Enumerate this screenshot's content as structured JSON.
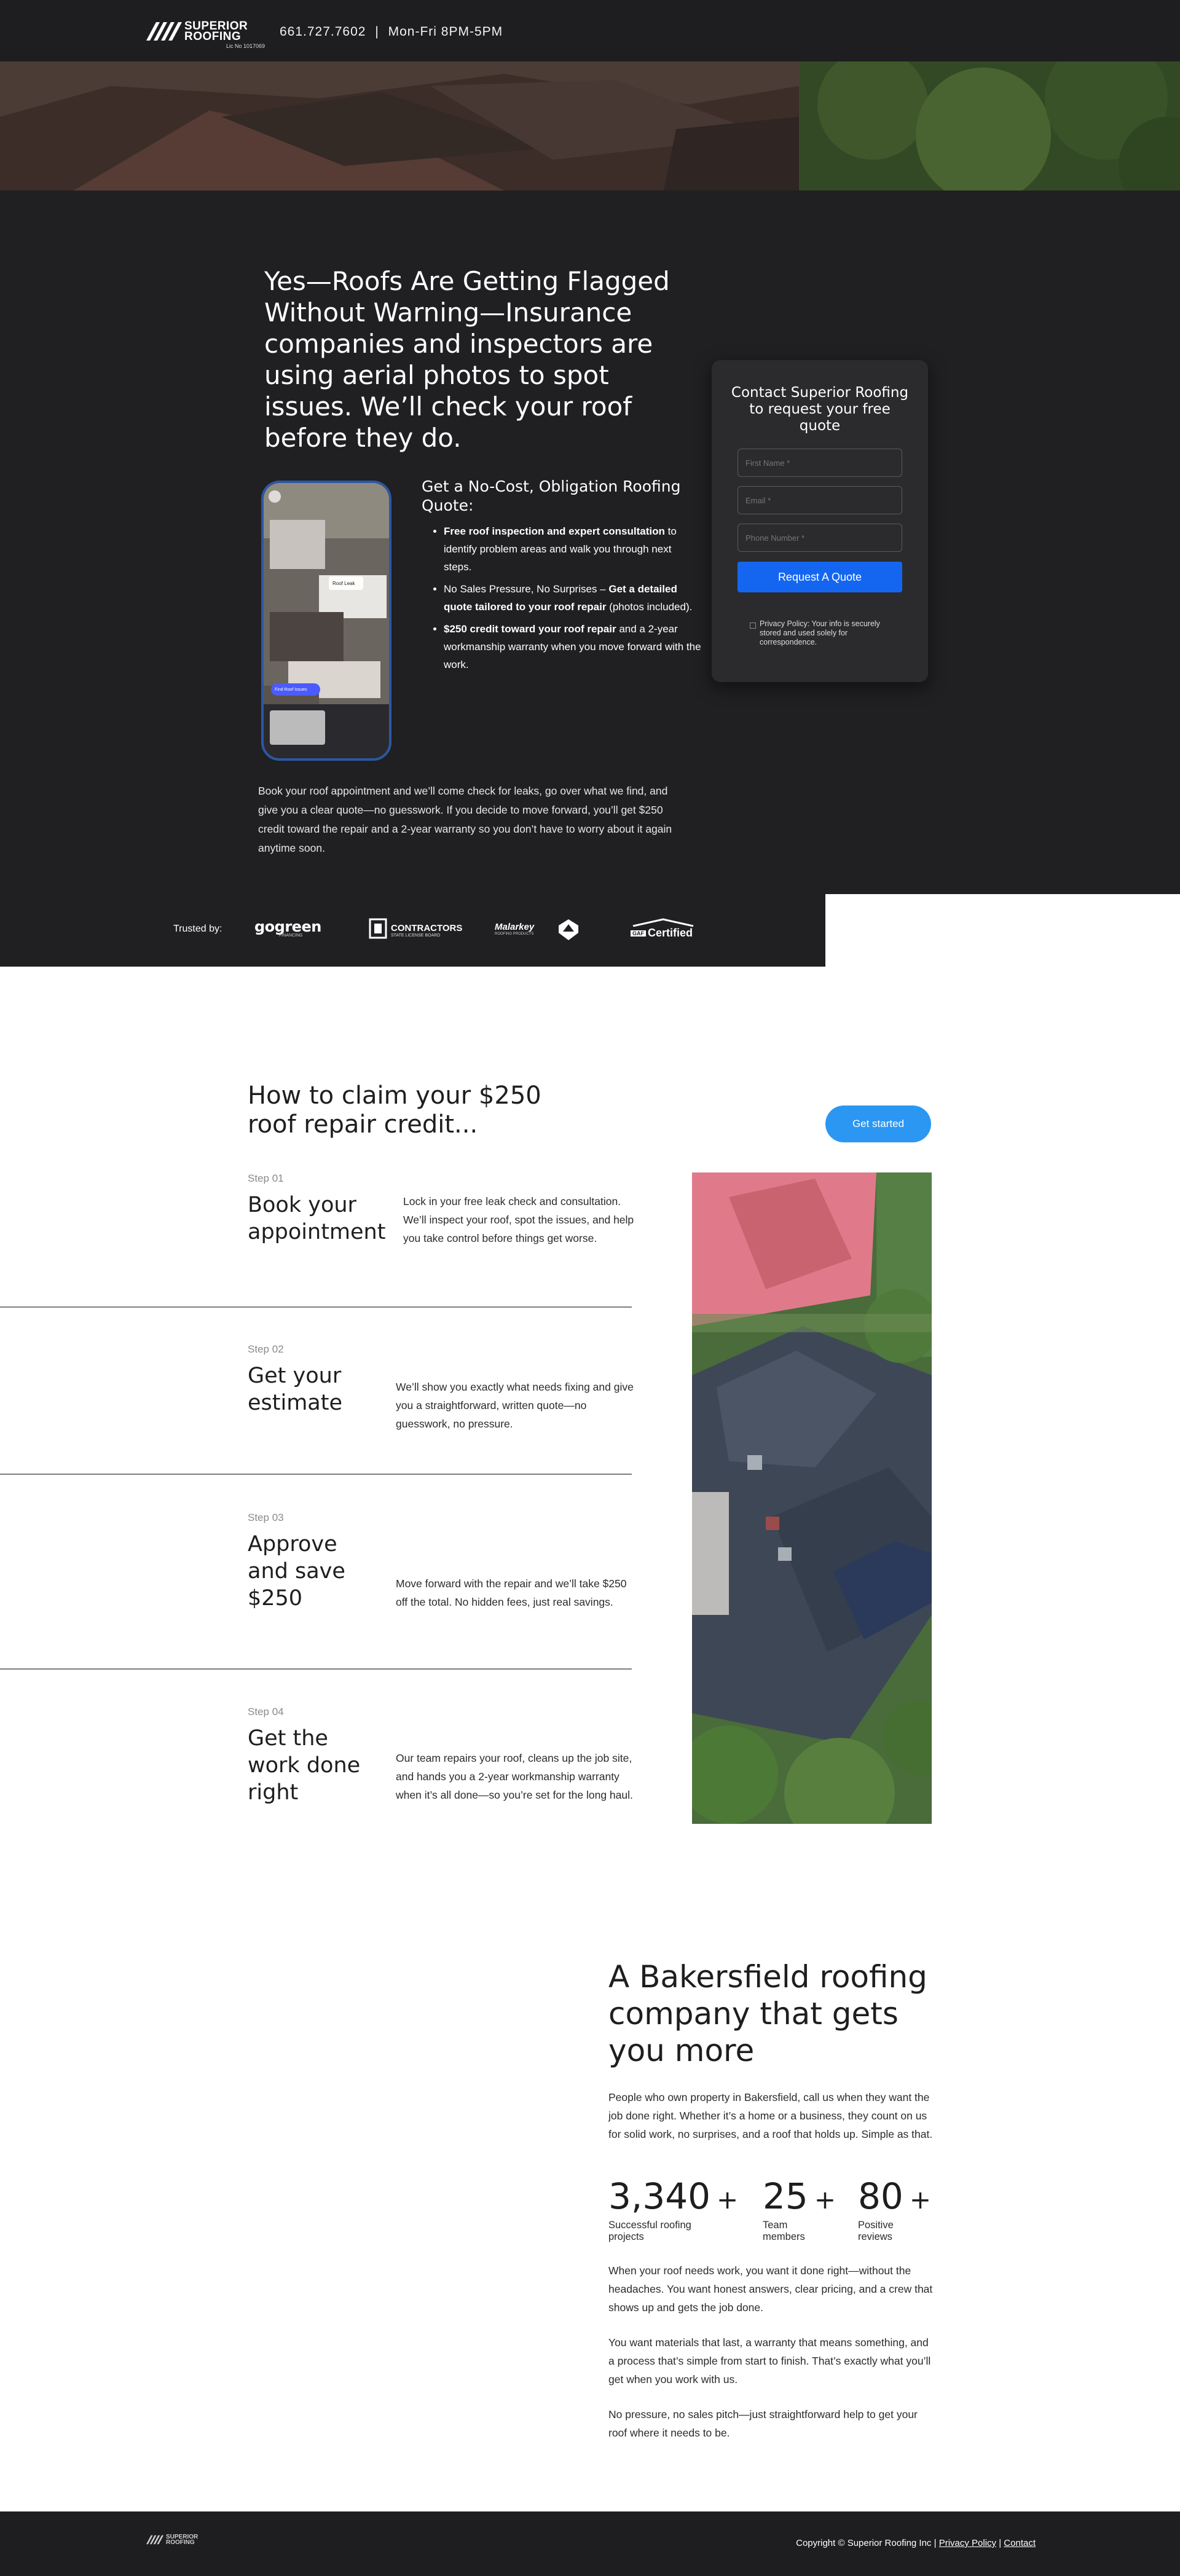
{
  "header": {
    "logo_top": "SUPERIOR",
    "logo_bottom": "ROOFING",
    "license": "Lic No 1017069",
    "phone": "661.727.7602",
    "separator": "|",
    "hours": "Mon-Fri 8PM-5PM"
  },
  "hero": {
    "headline": "Yes—Roofs Are Getting Flagged Without Warning—Insurance companies and inspectors are using aerial photos to spot issues. We’ll check your roof before they do.",
    "phone_badge": "Roof Leak",
    "phone_button": "Find Roof Issues",
    "offer_title": "Get a No-Cost, Obligation Roofing Quote:",
    "offer_items": [
      {
        "bold": "Free roof inspection and expert consultation",
        "text": " to identify problem areas and walk you through next steps."
      },
      {
        "pre": "No Sales Pressure, No Surprises – ",
        "bold": "Get a detailed quote tailored to your roof repair",
        "text": " (photos included)."
      },
      {
        "bold": "$250 credit toward your roof repair",
        "text": " and a 2-year workmanship warranty when you move forward with the work."
      }
    ],
    "paragraph": "Book your roof appointment and we’ll come check for leaks, go over what we find, and give you a clear quote—no guesswork. If you decide to move forward, you’ll get $250 credit toward the repair and a 2-year warranty so you don’t have to worry about it again anytime soon."
  },
  "form": {
    "title": "Contact Superior Roofing to request your free quote",
    "first_name_placeholder": "First Name *",
    "email_placeholder": "Email *",
    "phone_placeholder": "Phone Number *",
    "submit_label": "Request A Quote",
    "privacy": "Privacy Policy: Your info is securely stored and used solely for correspondence."
  },
  "trusted": {
    "label": "Trusted by:",
    "logos": [
      "gogreen",
      "CONTRACTORS",
      "Malarkey",
      "Certified"
    ],
    "logo_sub": [
      "FINANCING",
      "STATE LICENSE BOARD",
      "ROOFING PRODUCTS",
      "GAF"
    ]
  },
  "steps": {
    "heading": "How to claim your $250 roof repair credit...",
    "cta_label": "Get started",
    "items": [
      {
        "num": "Step 01",
        "title": "Book your appointment",
        "desc": "Lock in your free leak check and consultation. We’ll inspect your roof, spot the issues, and help you take control before things get worse."
      },
      {
        "num": "Step 02",
        "title": "Get your estimate",
        "desc": "We’ll show you exactly what needs fixing and give you a straightforward, written quote—no guesswork, no pressure."
      },
      {
        "num": "Step 03",
        "title": "Approve and save $250",
        "desc": "Move forward with the repair and we’ll take $250 off the total. No hidden fees, just real savings."
      },
      {
        "num": "Step 04",
        "title": "Get the work done right",
        "desc": "Our team repairs your roof, cleans up the job site, and hands you a 2-year workmanship warranty when it’s all done—so you’re set for the long haul."
      }
    ]
  },
  "about": {
    "heading": "A Bakersfield roofing company that gets you more",
    "intro": "People who own property in Bakersfield, call us when they want the job done right. Whether it’s a home or a business, they count on us for solid work, no surprises, and a roof that holds up. Simple as that.",
    "stats": [
      {
        "value": "3,340",
        "plus": "+",
        "label": "Successful roofing projects"
      },
      {
        "value": "25",
        "plus": "+",
        "label": "Team members"
      },
      {
        "value": "80",
        "plus": "+",
        "label": "Positive reviews"
      }
    ],
    "p1": "When your roof needs work, you want it done right—without the headaches. You want honest answers, clear pricing, and a crew that shows up and gets the job done.",
    "p2": "You want materials that last, a warranty that means something, and a process that’s simple from start to finish. That’s exactly what you’ll get when you work with us.",
    "p3": "No pressure, no sales pitch—just straightforward help to get your roof where it needs to be."
  },
  "footer": {
    "logo_top": "SUPERIOR",
    "logo_bottom": "ROOFING",
    "copyright": "Copyright © Superior Roofing Inc",
    "sep": "|",
    "privacy_link": "Privacy Policy",
    "contact_link": "Contact"
  },
  "colors": {
    "dark": "#1e1e20",
    "band": "#202022",
    "accent_blue": "#1466f0",
    "cta_blue": "#2b97f3"
  }
}
